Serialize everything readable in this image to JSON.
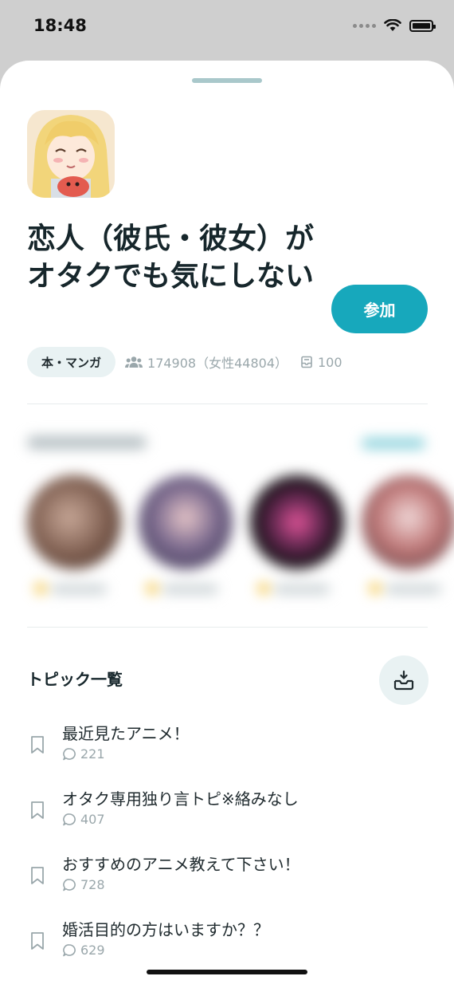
{
  "status_bar": {
    "time": "18:48"
  },
  "community": {
    "title": "恋人（彼氏・彼女）がオタクでも気にしない",
    "join_label": "参加",
    "category": "本・マンガ",
    "members_text": "174908（女性44804）",
    "posts_text": "100"
  },
  "topics": {
    "header": "トピック一覧",
    "items": [
      {
        "title": "最近見たアニメ！",
        "count": "221"
      },
      {
        "title": "オタク専用独り言トピ※絡みなし",
        "count": "407"
      },
      {
        "title": "おすすめのアニメ教えて下さい！",
        "count": "728"
      },
      {
        "title": "婚活目的の方はいますか？？",
        "count": "629"
      }
    ]
  },
  "colors": {
    "accent": "#17a8bc",
    "chip_bg": "#e9f2f3",
    "muted_text": "#9aa7ab"
  },
  "icons": [
    "wifi-icon",
    "battery-icon",
    "members-icon",
    "posts-icon",
    "inbox-add-icon",
    "bookmark-icon",
    "comment-icon"
  ]
}
